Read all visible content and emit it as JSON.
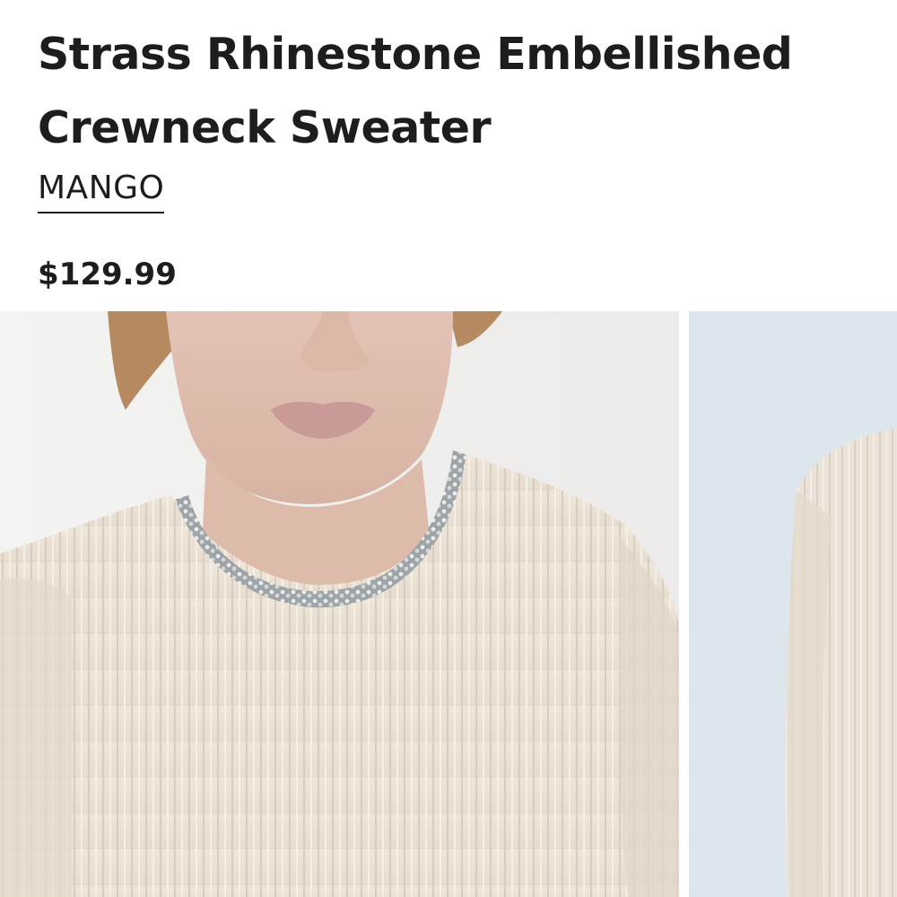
{
  "product": {
    "title": "Strass Rhinestone Embellished Crewneck Sweater",
    "brand": "MANGO",
    "price": "$129.99"
  },
  "gallery": {
    "images": [
      {
        "alt": "Model wearing cream ribbed crewneck sweater with rhinestone-embellished neckline"
      },
      {
        "alt": "Second view of cream ribbed sweater"
      }
    ]
  },
  "colors": {
    "text": "#1d1d1f",
    "sweater": "#ece3d6",
    "background_main": "#f1f0ee",
    "background_second": "#dde6ec"
  }
}
